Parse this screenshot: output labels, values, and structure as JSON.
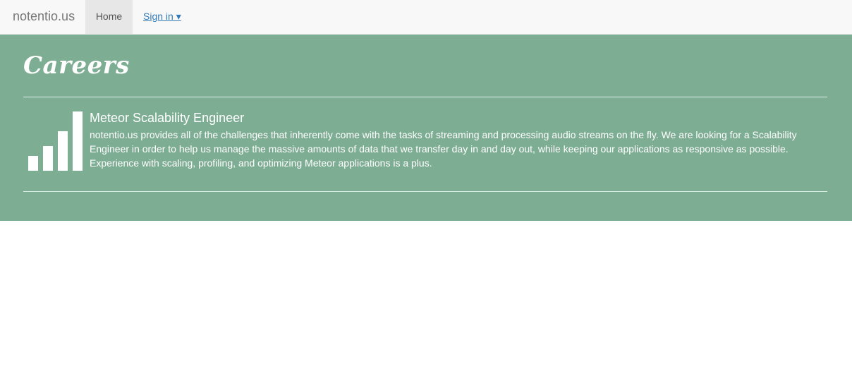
{
  "navbar": {
    "brand": "notentio.us",
    "home_label": "Home",
    "signin_label": "Sign in ▾"
  },
  "page": {
    "title": "Careers"
  },
  "job": {
    "icon": "signal-bars-icon",
    "title": "Meteor Scalability Engineer",
    "description": "notentio.us provides all of the challenges that inherently come with the tasks of streaming and processing audio streams on the fly. We are looking for a Scalability Engineer in order to help us manage the massive amounts of data that we transfer day in and day out, while keeping our applications as responsive as possible. Experience with scaling, profiling, and optimizing Meteor applications is a plus."
  },
  "colors": {
    "hero_background": "#7dad93",
    "navbar_background": "#f8f8f8",
    "link": "#337ab7"
  }
}
